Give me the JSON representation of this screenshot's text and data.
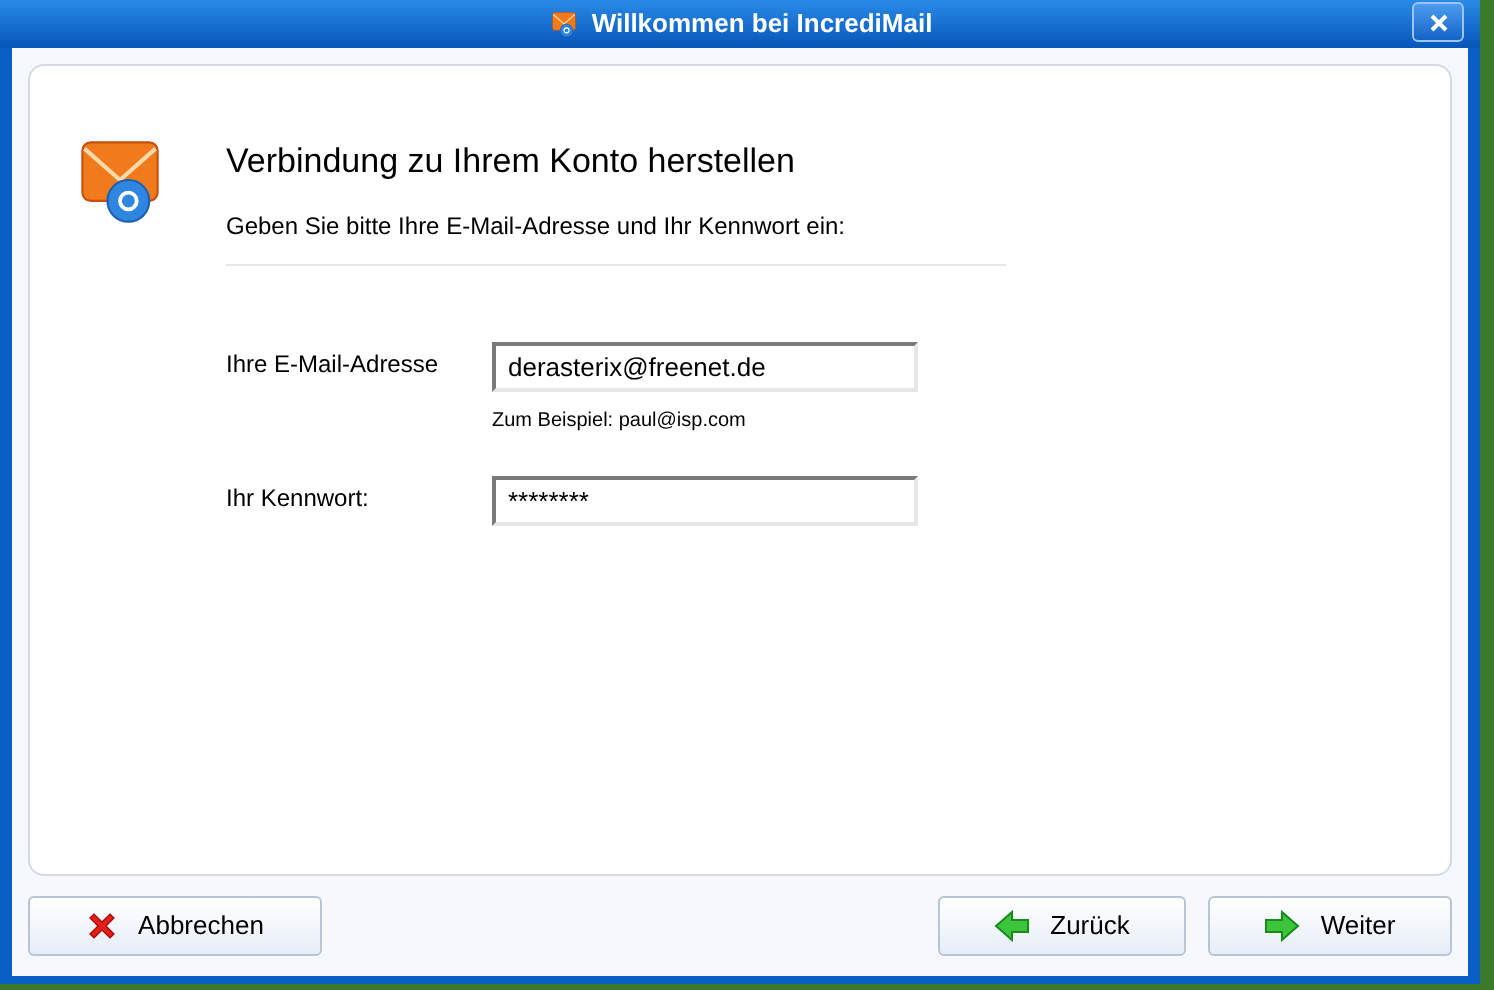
{
  "window": {
    "title": "Willkommen bei IncrediMail"
  },
  "heading": "Verbindung zu Ihrem Konto herstellen",
  "instruction": "Geben Sie bitte Ihre E-Mail-Adresse und Ihr Kennwort ein:",
  "fields": [
    {
      "label": "Ihre E-Mail-Adresse",
      "value": "derasterix@freenet.de",
      "hint": "Zum Beispiel: paul@isp.com"
    },
    {
      "label": "Ihr Kennwort:",
      "value": "********"
    }
  ],
  "buttons": [
    {
      "kind": "cancel",
      "label": "Abbrechen"
    },
    {
      "kind": "back",
      "label": "Zurück"
    },
    {
      "kind": "next",
      "label": "Weiter"
    }
  ]
}
